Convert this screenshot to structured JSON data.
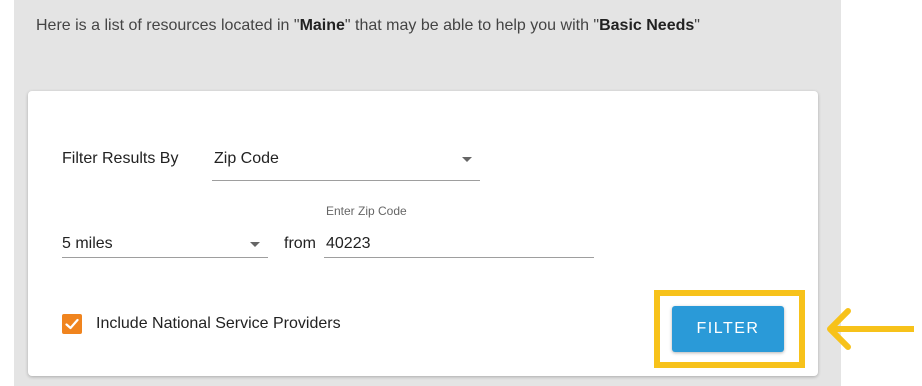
{
  "intro": {
    "prefix": "Here is a list of resources located in \"",
    "location": "Maine",
    "middle": "\" that may be able to help you with \"",
    "category": "Basic Needs",
    "suffix": "\""
  },
  "filter": {
    "filter_by_label": "Filter Results By",
    "filter_by_value": "Zip Code",
    "distance_value": "5 miles",
    "from_label": "from",
    "zip_label": "Enter Zip Code",
    "zip_value": "40223",
    "national_checkbox_label": "Include National Service Providers",
    "national_checked": true,
    "button_label": "FILTER"
  },
  "colors": {
    "accent": "#2a9ad8",
    "checkbox": "#f0841e",
    "highlight": "#f7c21a",
    "panel_bg": "#e4e4e4"
  },
  "icons": {
    "dropdown": "chevron-down-icon",
    "check": "checkmark-icon",
    "annotation": "arrow-left-icon"
  }
}
